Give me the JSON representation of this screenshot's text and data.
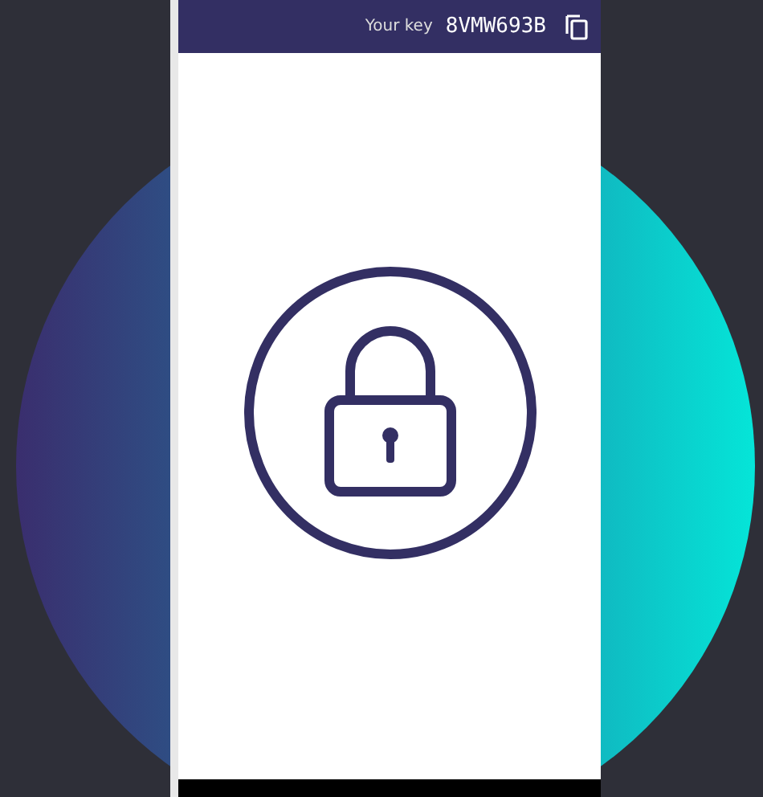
{
  "header": {
    "key_label": "Your key",
    "key": "8VMW693B"
  }
}
